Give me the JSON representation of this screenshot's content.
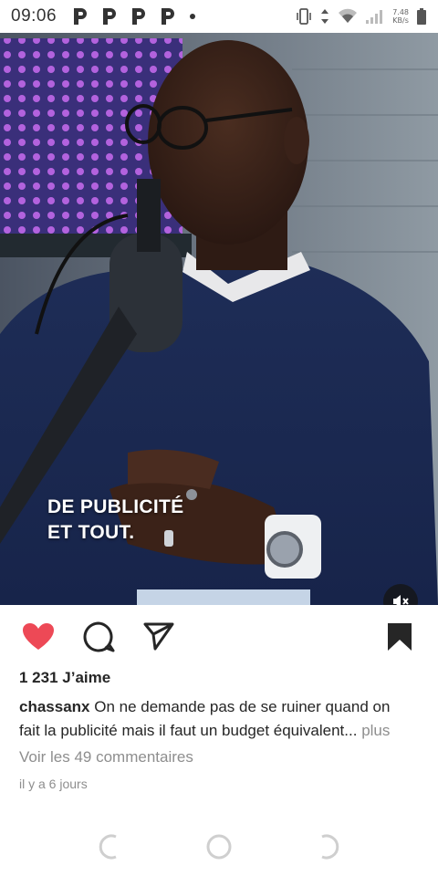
{
  "status_bar": {
    "time": "09:06",
    "notification_icons": [
      "p-icon",
      "p-icon",
      "p-icon",
      "p-icon"
    ],
    "net_speed_value": "7.48",
    "net_speed_unit": "KB/s"
  },
  "video": {
    "caption_line1": "DE PUBLICITÉ",
    "caption_line2": "ET TOUT.",
    "muted": true
  },
  "actions": {
    "liked": true,
    "saved": true,
    "like_color": "#ed4956"
  },
  "post": {
    "likes": "1 231 J’aime",
    "username": "chassanx",
    "caption_line1": "On ne demande pas de se ruiner quand on",
    "caption_line2": "fait la publicité mais il faut un budget équivalent",
    "ellipsis": "...",
    "more": "plus",
    "comments_link": "Voir les 49 commentaires",
    "time_ago": "il y a 6 jours"
  },
  "nav": {
    "back": "back-button",
    "home": "home-button",
    "recents": "recents-button"
  }
}
